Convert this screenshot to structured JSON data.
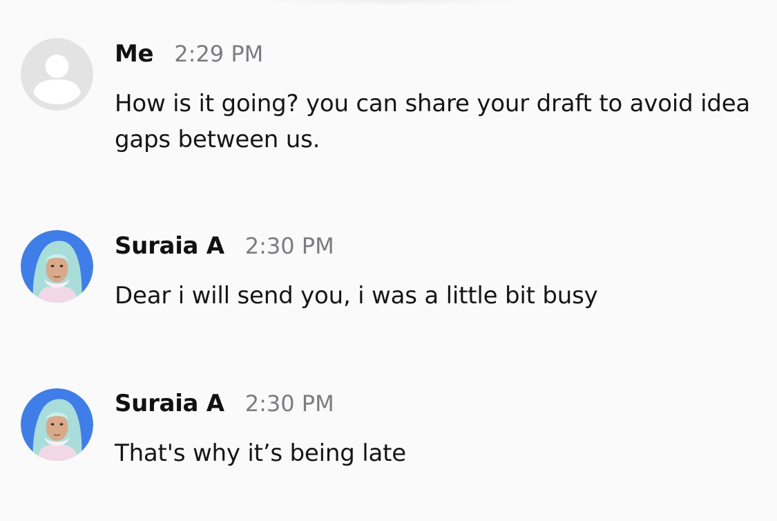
{
  "messages": [
    {
      "sender": "Me",
      "time": "2:29 PM",
      "text": "How is it going? you can share your draft to avoid idea gaps between us.",
      "avatar": "default-user-icon"
    },
    {
      "sender": "Suraia A",
      "time": "2:30 PM",
      "text": "Dear i will send you, i was a little bit busy",
      "avatar": "profile-photo"
    },
    {
      "sender": "Suraia A",
      "time": "2:30 PM",
      "text": "That's why it’s being late",
      "avatar": "profile-photo"
    }
  ],
  "colors": {
    "background": "#fafafa",
    "time": "#7b7b80",
    "avatar_placeholder": "#e0e0e0",
    "avatar_photo_bg": "#3f7de8"
  }
}
